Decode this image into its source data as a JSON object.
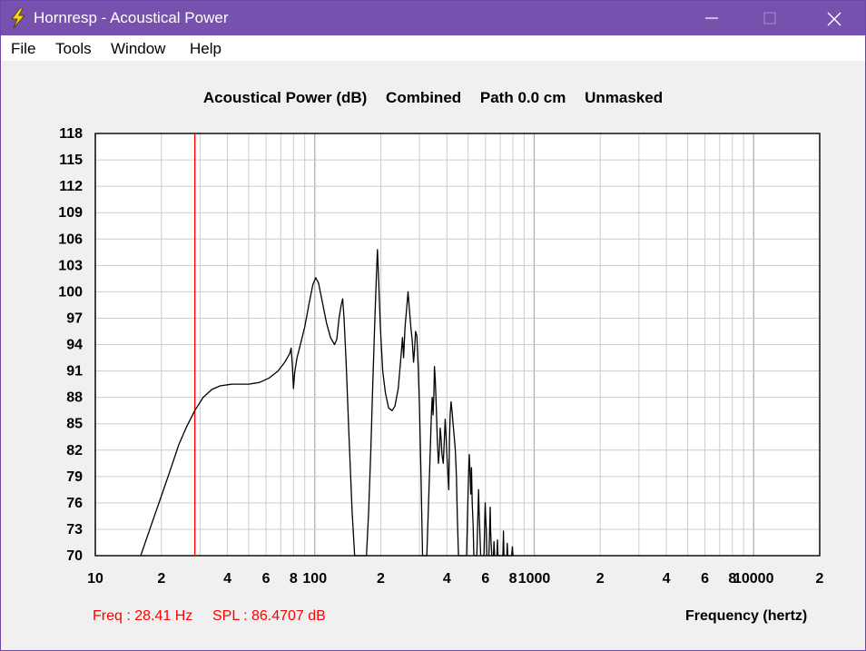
{
  "window": {
    "title": "Hornresp - Acoustical Power",
    "icon": "lightning-bolt-icon",
    "controls": [
      "minimize-icon",
      "maximize-icon",
      "close-icon"
    ]
  },
  "menu": {
    "file": "File",
    "tools": "Tools",
    "window": "Window",
    "help": "Help"
  },
  "chart_header": {
    "quantity": "Acoustical Power (dB)",
    "mode": "Combined",
    "path": "Path 0.0 cm",
    "mask": "Unmasked"
  },
  "readout": {
    "freq": "Freq : 28.41 Hz",
    "spl": "SPL : 86.4707 dB"
  },
  "colors": {
    "titlebar": "#7751ad",
    "cursor": "#ff0000",
    "trace": "#000000",
    "grid": "#cccccc"
  },
  "chart_data": {
    "type": "line",
    "title": "Acoustical Power (dB)   Combined   Path 0.0 cm   Unmasked",
    "xlabel": "Frequency (hertz)",
    "ylabel": "",
    "xscale": "log",
    "xlim": [
      10,
      20000
    ],
    "ylim": [
      70,
      118
    ],
    "yticks": [
      118,
      115,
      112,
      109,
      106,
      103,
      100,
      97,
      94,
      91,
      88,
      85,
      82,
      79,
      76,
      73,
      70
    ],
    "xtick_labels": [
      {
        "f": 10,
        "label": "10"
      },
      {
        "f": 20,
        "label": "2"
      },
      {
        "f": 40,
        "label": "4"
      },
      {
        "f": 60,
        "label": "6"
      },
      {
        "f": 80,
        "label": "8"
      },
      {
        "f": 100,
        "label": "100"
      },
      {
        "f": 200,
        "label": "2"
      },
      {
        "f": 400,
        "label": "4"
      },
      {
        "f": 600,
        "label": "6"
      },
      {
        "f": 800,
        "label": "8"
      },
      {
        "f": 1000,
        "label": "1000"
      },
      {
        "f": 2000,
        "label": "2"
      },
      {
        "f": 4000,
        "label": "4"
      },
      {
        "f": 6000,
        "label": "6"
      },
      {
        "f": 8000,
        "label": "8"
      },
      {
        "f": 10000,
        "label": "10000"
      },
      {
        "f": 20000,
        "label": "2"
      }
    ],
    "grid": true,
    "cursor_freq": 28.41,
    "series": [
      {
        "points": [
          [
            16.1,
            70
          ],
          [
            18,
            73.5
          ],
          [
            20,
            76.8
          ],
          [
            22,
            79.8
          ],
          [
            24,
            82.6
          ],
          [
            26,
            84.6
          ],
          [
            28.4,
            86.5
          ],
          [
            31,
            88.0
          ],
          [
            34,
            88.9
          ],
          [
            37,
            89.3
          ],
          [
            42,
            89.5
          ],
          [
            50,
            89.5
          ],
          [
            56,
            89.7
          ],
          [
            62,
            90.2
          ],
          [
            68,
            91.0
          ],
          [
            73,
            92.0
          ],
          [
            77,
            93.0
          ],
          [
            78,
            93.6
          ],
          [
            79,
            91.8
          ],
          [
            80,
            89.0
          ],
          [
            81,
            90.8
          ],
          [
            83,
            92.5
          ],
          [
            86,
            94.0
          ],
          [
            90,
            96.0
          ],
          [
            94,
            98.5
          ],
          [
            98,
            100.8
          ],
          [
            101,
            101.6
          ],
          [
            104,
            101.0
          ],
          [
            108,
            99.0
          ],
          [
            113,
            96.5
          ],
          [
            118,
            94.8
          ],
          [
            123,
            94.0
          ],
          [
            126,
            94.6
          ],
          [
            129,
            97.0
          ],
          [
            132,
            98.5
          ],
          [
            134,
            99.2
          ],
          [
            136,
            97.0
          ],
          [
            139,
            92.0
          ],
          [
            143,
            84.0
          ],
          [
            148,
            75.0
          ],
          [
            152,
            70
          ],
          [
            172,
            70
          ],
          [
            176,
            75.0
          ],
          [
            180,
            82.0
          ],
          [
            184,
            90.0
          ],
          [
            188,
            97.0
          ],
          [
            191,
            102.0
          ],
          [
            193,
            104.8
          ],
          [
            195,
            102.0
          ],
          [
            199,
            96.0
          ],
          [
            204,
            91.0
          ],
          [
            210,
            88.5
          ],
          [
            217,
            86.8
          ],
          [
            225,
            86.5
          ],
          [
            232,
            87.0
          ],
          [
            240,
            89.0
          ],
          [
            246,
            92.0
          ],
          [
            251,
            94.8
          ],
          [
            254,
            92.5
          ],
          [
            258,
            96.0
          ],
          [
            263,
            98.5
          ],
          [
            266,
            100.0
          ],
          [
            270,
            98.0
          ],
          [
            274,
            96.0
          ],
          [
            278,
            94.5
          ],
          [
            282,
            92.0
          ],
          [
            285,
            93.5
          ],
          [
            288,
            95.5
          ],
          [
            292,
            95.0
          ],
          [
            296,
            91.5
          ],
          [
            300,
            87.0
          ],
          [
            305,
            79.0
          ],
          [
            310,
            70
          ],
          [
            324,
            70
          ],
          [
            330,
            76.0
          ],
          [
            336,
            82.0
          ],
          [
            340,
            86.0
          ],
          [
            343,
            88.0
          ],
          [
            346,
            86.0
          ],
          [
            349,
            88.5
          ],
          [
            351,
            91.5
          ],
          [
            354,
            90.0
          ],
          [
            358,
            87.0
          ],
          [
            362,
            83.0
          ],
          [
            366,
            80.5
          ],
          [
            370,
            82.0
          ],
          [
            373,
            84.5
          ],
          [
            376,
            83.5
          ],
          [
            380,
            81.5
          ],
          [
            385,
            80.5
          ],
          [
            389,
            83.0
          ],
          [
            393,
            85.5
          ],
          [
            396,
            84.0
          ],
          [
            400,
            81.5
          ],
          [
            404,
            79.5
          ],
          [
            408,
            77.5
          ],
          [
            411,
            83.0
          ],
          [
            414,
            86.0
          ],
          [
            418,
            87.5
          ],
          [
            422,
            86.5
          ],
          [
            427,
            85.0
          ],
          [
            432,
            83.5
          ],
          [
            437,
            82.0
          ],
          [
            442,
            79.0
          ],
          [
            447,
            74.0
          ],
          [
            452,
            70
          ],
          [
            492,
            70
          ],
          [
            497,
            75.0
          ],
          [
            502,
            79.0
          ],
          [
            506,
            81.5
          ],
          [
            510,
            79.5
          ],
          [
            514,
            77.0
          ],
          [
            518,
            80.0
          ],
          [
            522,
            76.0
          ],
          [
            527,
            73.5
          ],
          [
            531,
            70
          ],
          [
            548,
            70
          ],
          [
            553,
            74.0
          ],
          [
            558,
            77.5
          ],
          [
            561,
            75.0
          ],
          [
            565,
            73.0
          ],
          [
            570,
            70
          ],
          [
            590,
            70
          ],
          [
            594,
            73.0
          ],
          [
            598,
            76.0
          ],
          [
            601,
            74.5
          ],
          [
            605,
            73.0
          ],
          [
            609,
            70
          ],
          [
            622,
            70
          ],
          [
            626,
            72.5
          ],
          [
            630,
            75.5
          ],
          [
            633,
            72.8
          ],
          [
            637,
            71.2
          ],
          [
            641,
            70
          ],
          [
            652,
            70
          ],
          [
            656,
            71.6
          ],
          [
            660,
            70
          ],
          [
            676,
            70
          ],
          [
            680,
            71.8
          ],
          [
            684,
            70
          ],
          [
            720,
            70
          ],
          [
            724,
            72.8
          ],
          [
            728,
            70
          ],
          [
            750,
            70
          ],
          [
            754,
            71.4
          ],
          [
            758,
            70
          ],
          [
            790,
            70
          ],
          [
            795,
            71.0
          ],
          [
            800,
            70
          ]
        ]
      }
    ]
  }
}
